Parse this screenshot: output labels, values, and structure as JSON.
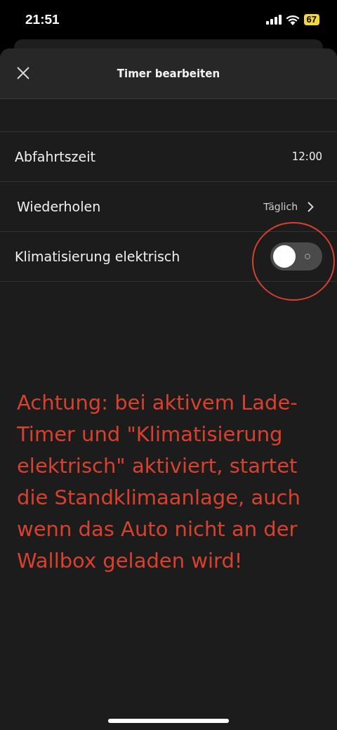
{
  "status_bar": {
    "time": "21:51",
    "battery": "67"
  },
  "header": {
    "title": "Timer bearbeiten"
  },
  "rows": [
    {
      "kind": "value",
      "label": "Abfahrtszeit",
      "value": "12:00"
    },
    {
      "kind": "link",
      "label": "Wiederholen",
      "value": "Täglich"
    },
    {
      "kind": "toggle",
      "label": "Klimatisierung elektrisch",
      "on": false
    }
  ],
  "annotation": {
    "text": "Achtung: bei aktivem Lade-Timer und \"Klimatisierung elektrisch\" aktiviert, startet die Standklimaanlage, auch wenn das Auto nicht an der Wallbox geladen wird!"
  }
}
